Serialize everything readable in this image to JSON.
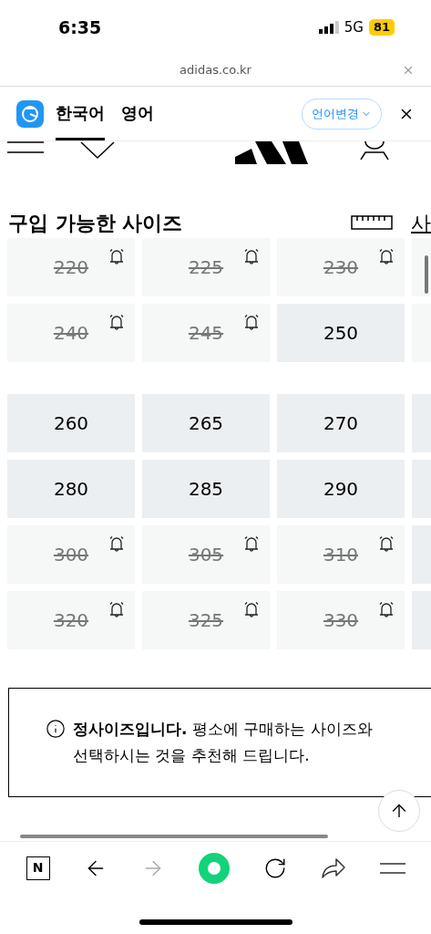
{
  "status_bar": {
    "time": "6:35",
    "network": "5G",
    "battery": "81"
  },
  "url_bar": {
    "domain": "adidas.co.kr"
  },
  "translate_bar": {
    "tabs": [
      {
        "label": "한국어",
        "selected": true
      },
      {
        "label": "영어",
        "selected": false
      }
    ],
    "change_button": "언어변경"
  },
  "size_section": {
    "title": "구입 가능한 사이즈",
    "size_guide_link": "사",
    "sizes": [
      {
        "label": "220",
        "available": false
      },
      {
        "label": "225",
        "available": false
      },
      {
        "label": "230",
        "available": false
      },
      {
        "label": "240",
        "available": false
      },
      {
        "label": "245",
        "available": false
      },
      {
        "label": "250",
        "available": true
      },
      {
        "label": "260",
        "available": true
      },
      {
        "label": "265",
        "available": true
      },
      {
        "label": "270",
        "available": true
      },
      {
        "label": "280",
        "available": true
      },
      {
        "label": "285",
        "available": true
      },
      {
        "label": "290",
        "available": true
      },
      {
        "label": "300",
        "available": false
      },
      {
        "label": "305",
        "available": false
      },
      {
        "label": "310",
        "available": false
      },
      {
        "label": "320",
        "available": false
      },
      {
        "label": "325",
        "available": false
      },
      {
        "label": "330",
        "available": false
      }
    ]
  },
  "fit_notice": {
    "line_1": "**정사이즈입니다.** 평소에 구매하는 사이즈와",
    "line_2": "선택하시는 것을 추천해 드립니다."
  },
  "toolbar": {
    "home_label": "N"
  }
}
